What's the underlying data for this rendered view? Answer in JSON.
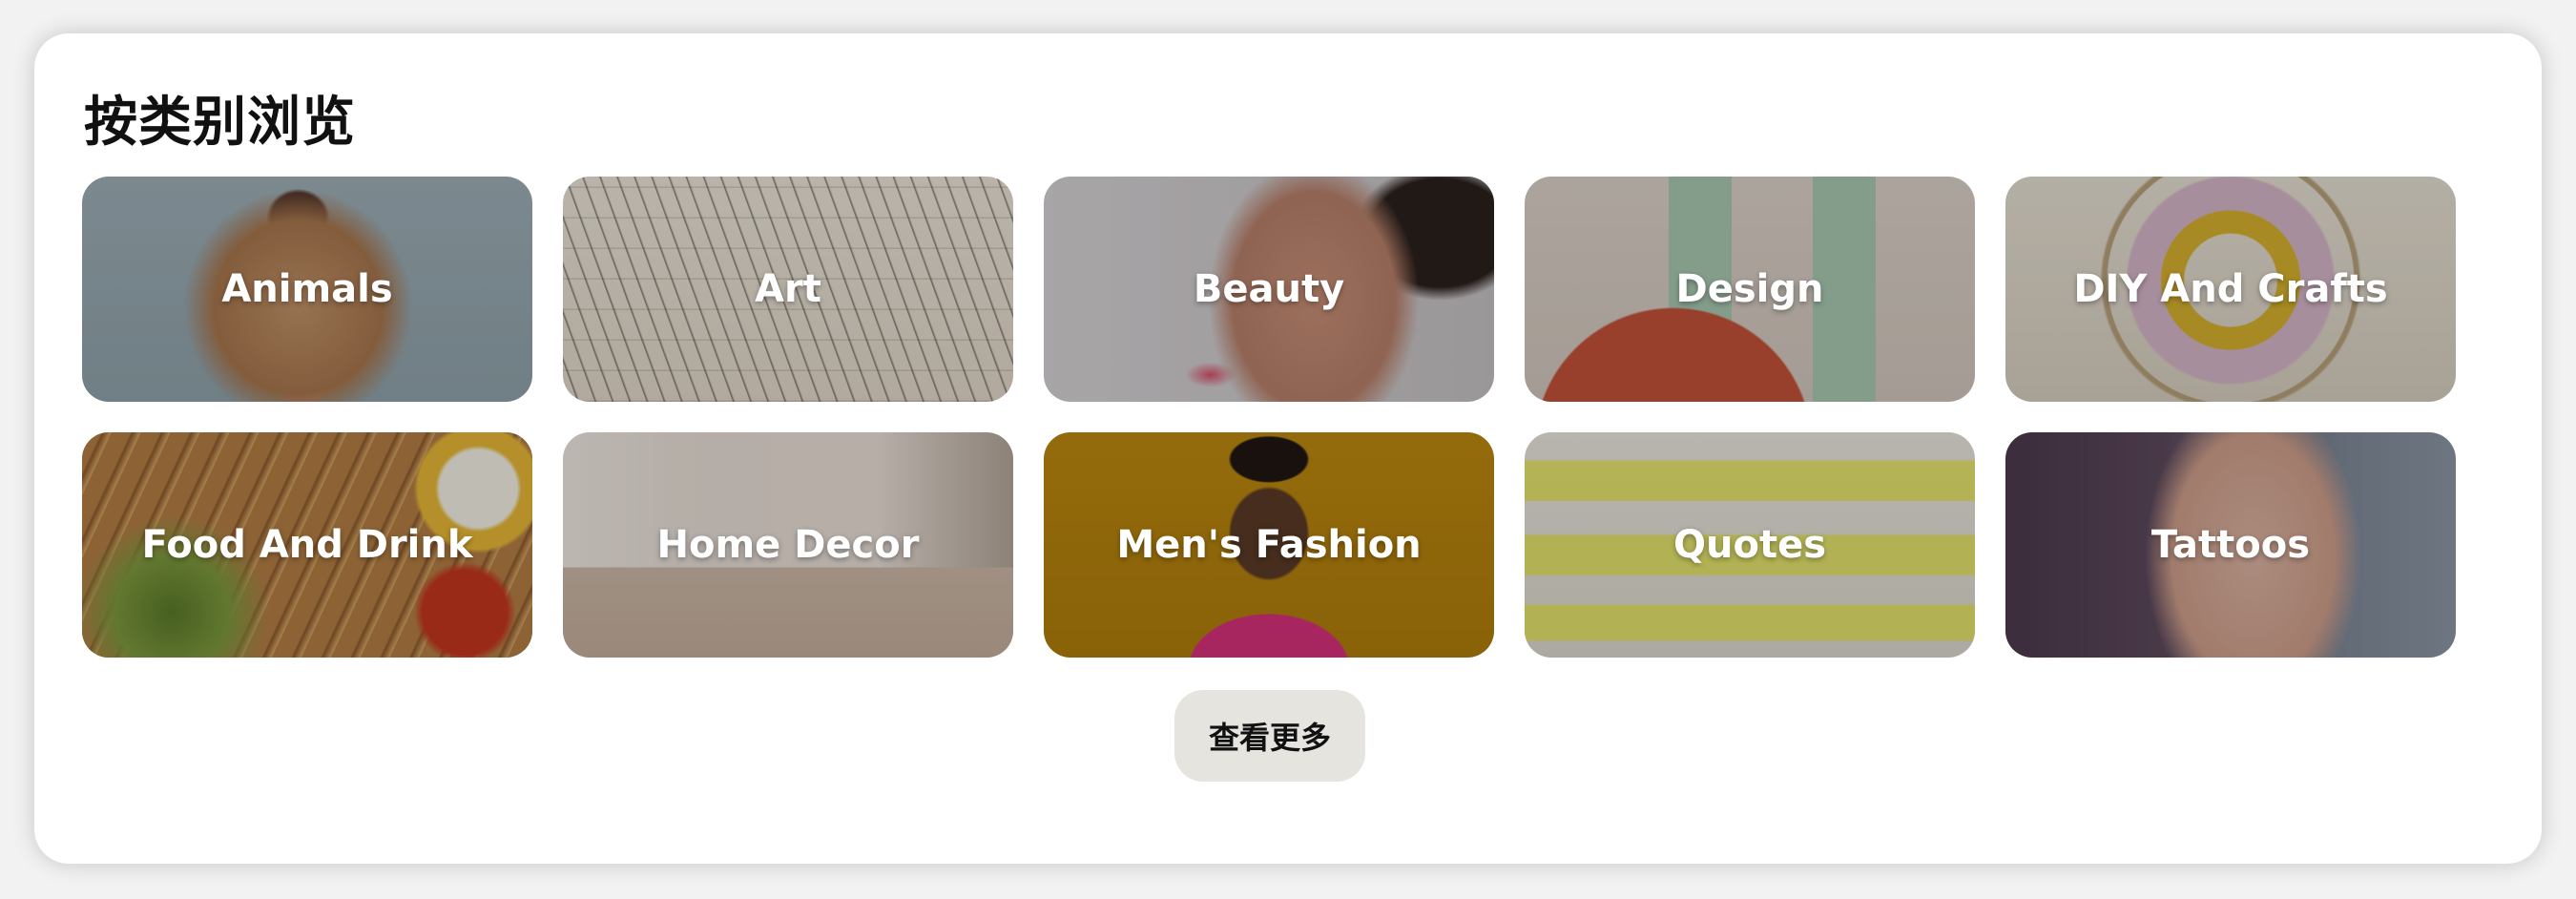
{
  "section": {
    "title": "按类别浏览",
    "more_button_label": "查看更多"
  },
  "categories": [
    {
      "label": "Animals",
      "icon": "dog-photo",
      "colors": [
        "#9aadb6",
        "#b58860"
      ]
    },
    {
      "label": "Art",
      "icon": "sketch-photo",
      "colors": [
        "#e9e1d4",
        "#3a332d"
      ]
    },
    {
      "label": "Beauty",
      "icon": "portrait-photo",
      "colors": [
        "#d7d4d6",
        "#c88d7a"
      ]
    },
    {
      "label": "Design",
      "icon": "abstract-photo",
      "colors": [
        "#d9cfc6",
        "#a9c9b3",
        "#c5533a"
      ]
    },
    {
      "label": "DIY And Crafts",
      "icon": "embroidery-photo",
      "colors": [
        "#e3dccf",
        "#d9b23a"
      ]
    },
    {
      "label": "Food And Drink",
      "icon": "salad-photo",
      "colors": [
        "#6a7a3a",
        "#d7a35a"
      ]
    },
    {
      "label": "Home Decor",
      "icon": "livingroom-photo",
      "colors": [
        "#e7ddd6",
        "#c8b8ab"
      ]
    },
    {
      "label": "Men's Fashion",
      "icon": "fashion-photo",
      "colors": [
        "#b5820f",
        "#d8317c"
      ]
    },
    {
      "label": "Quotes",
      "icon": "quote-photo",
      "colors": [
        "#e6e3d7",
        "#e6e64a"
      ]
    },
    {
      "label": "Tattoos",
      "icon": "tattoo-photo",
      "colors": [
        "#59465a",
        "#d4a696"
      ]
    }
  ]
}
